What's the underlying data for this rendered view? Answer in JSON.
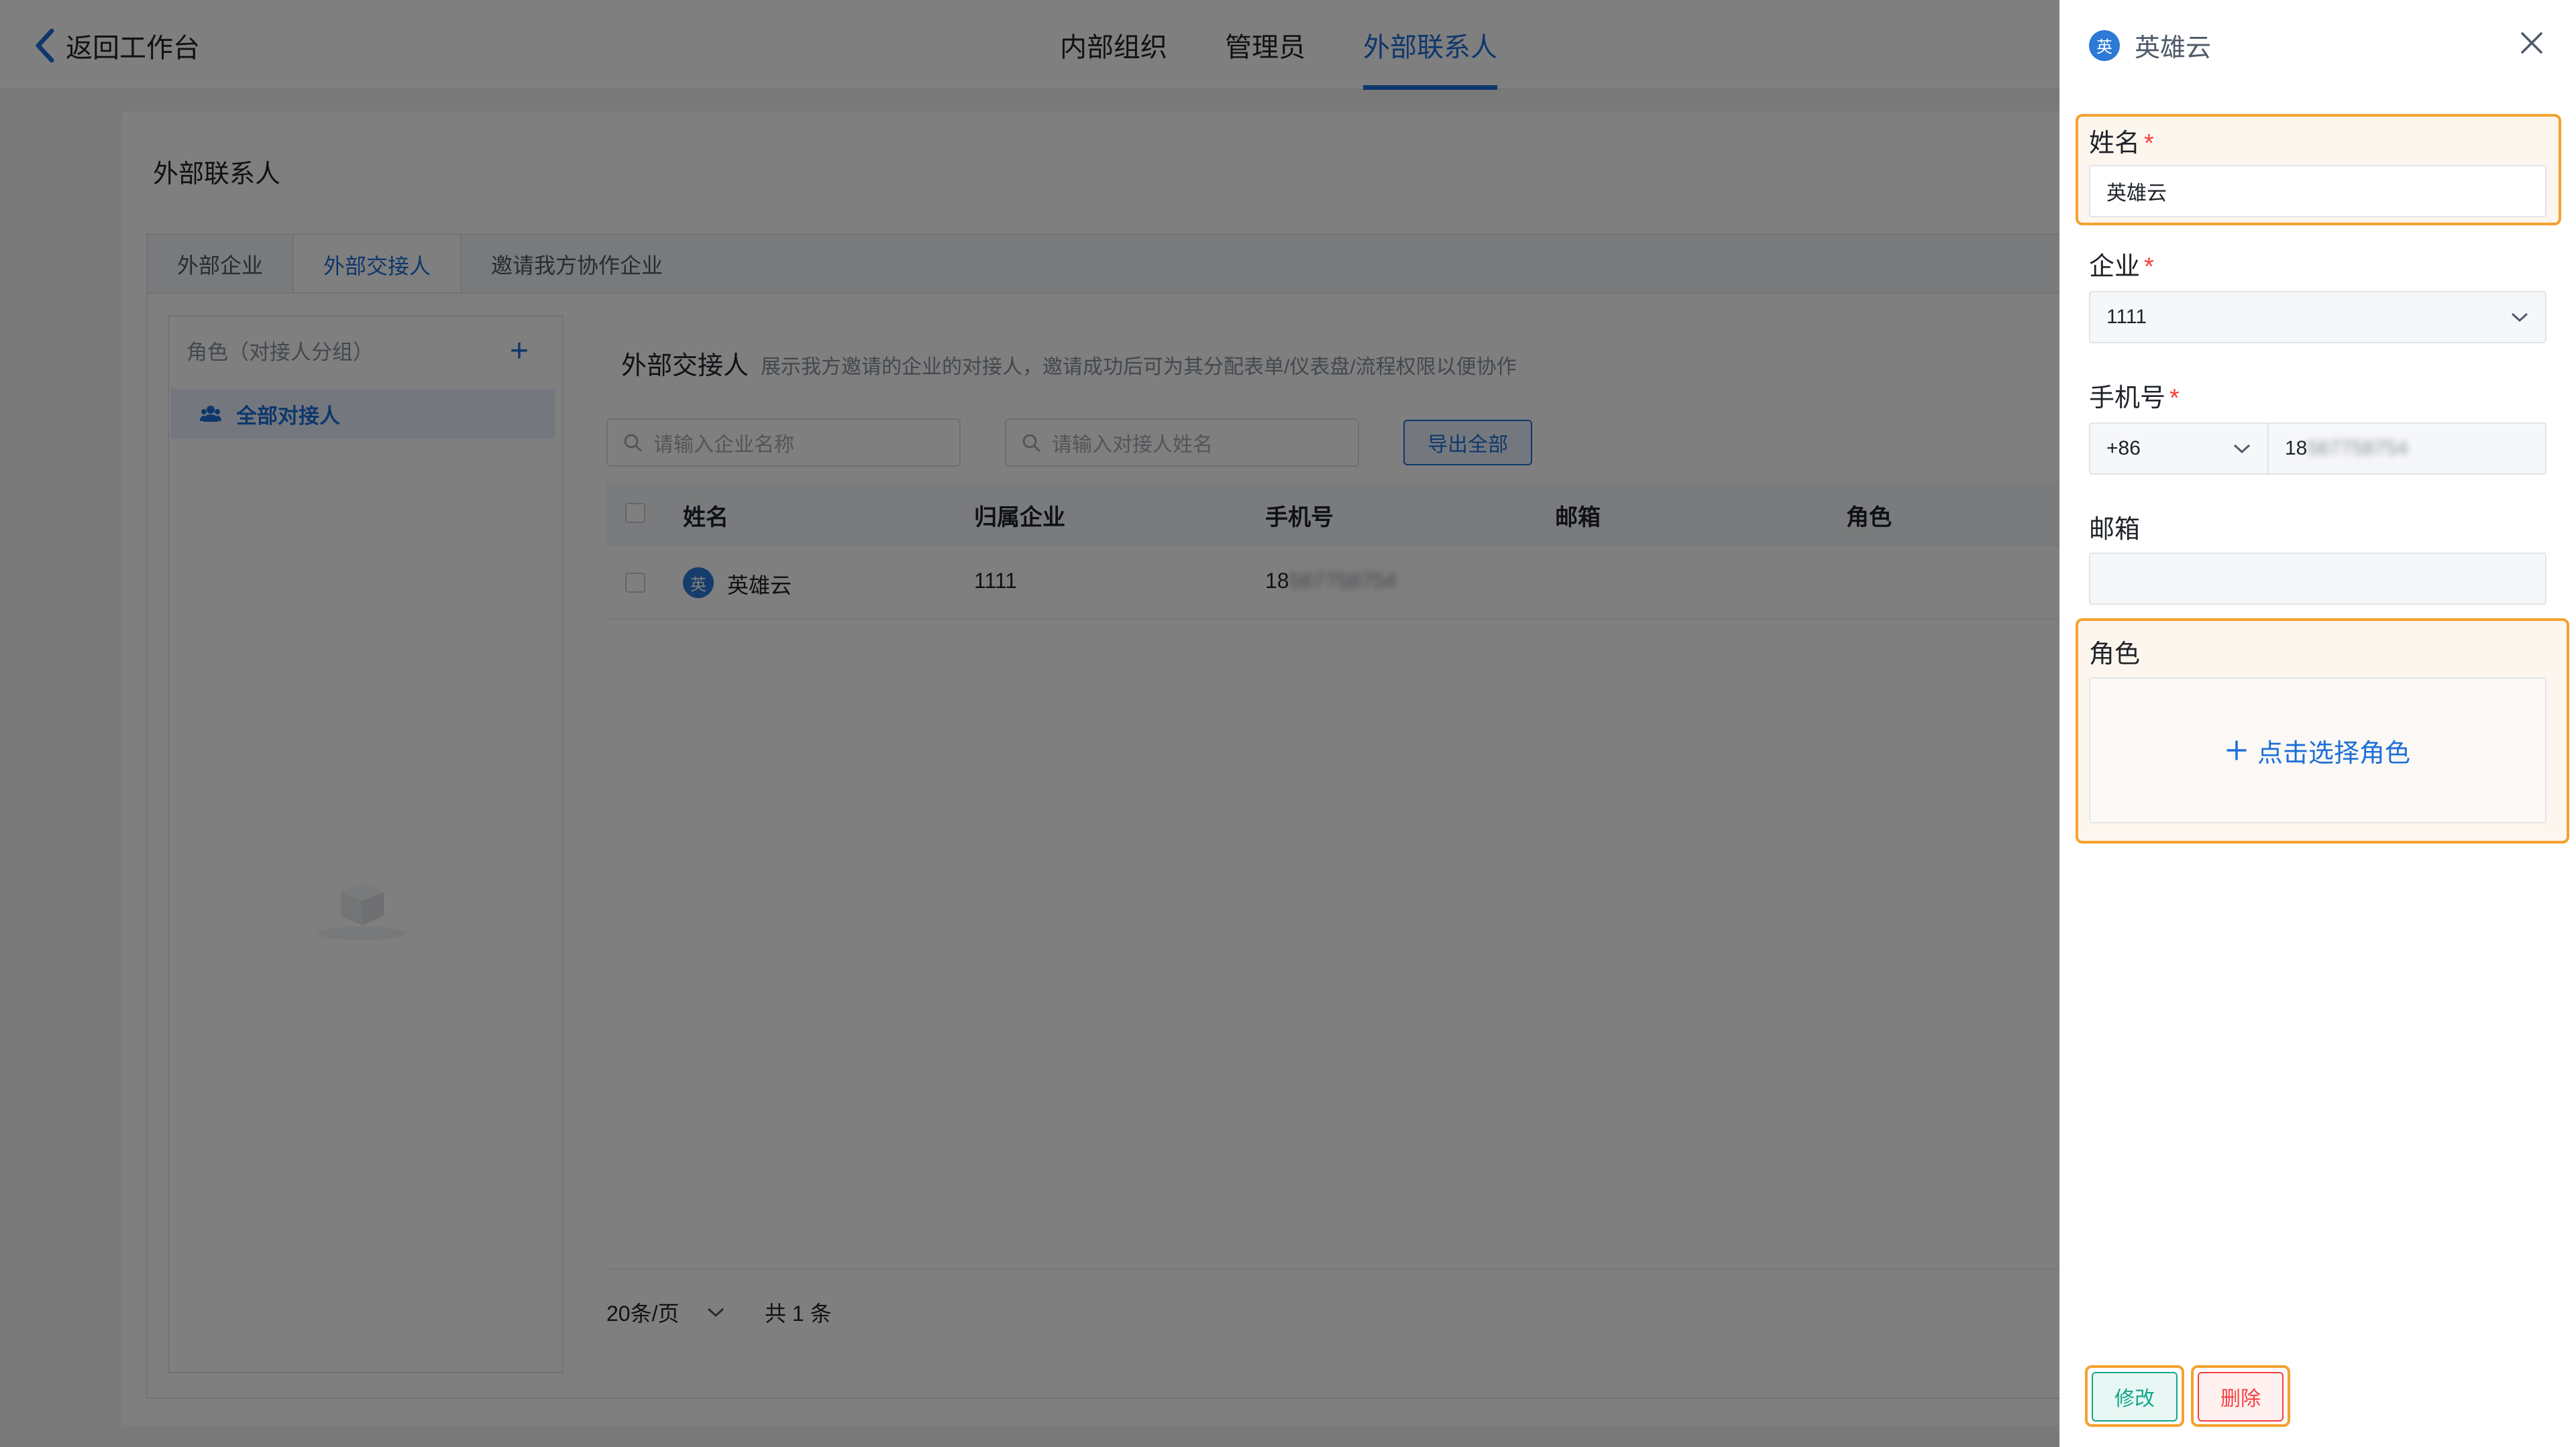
{
  "topbar": {
    "back_label": "返回工作台",
    "tabs": [
      {
        "label": "内部组织",
        "active": false
      },
      {
        "label": "管理员",
        "active": false
      },
      {
        "label": "外部联系人",
        "active": true
      }
    ]
  },
  "page": {
    "title": "外部联系人",
    "subtabs": [
      {
        "label": "外部企业",
        "active": false
      },
      {
        "label": "外部交接人",
        "active": true
      },
      {
        "label": "邀请我方协作企业",
        "active": false
      }
    ]
  },
  "role_panel": {
    "header": "角色（对接人分组）",
    "add_symbol": "+",
    "items": [
      {
        "label": "全部对接人",
        "icon": "users-icon",
        "selected": true
      }
    ]
  },
  "contacts": {
    "title": "外部交接人",
    "description": "展示我方邀请的企业的对接人，邀请成功后可为其分配表单/仪表盘/流程权限以便协作",
    "search_company_placeholder": "请输入企业名称",
    "search_name_placeholder": "请输入对接人姓名",
    "export_label": "导出全部",
    "columns": [
      "姓名",
      "归属企业",
      "手机号",
      "邮箱",
      "角色"
    ],
    "rows": [
      {
        "avatar": "英",
        "name": "英雄云",
        "company": "1111",
        "phone_prefix": "18",
        "phone_masked": "567758754",
        "email": "",
        "role": ""
      }
    ],
    "pager": {
      "page_size": "20条/页",
      "total": "共 1 条"
    }
  },
  "drawer": {
    "avatar": "英",
    "title": "英雄云",
    "fields": {
      "name": {
        "label": "姓名",
        "required": "*",
        "value": "英雄云"
      },
      "company": {
        "label": "企业",
        "required": "*",
        "value": "1111"
      },
      "phone": {
        "label": "手机号",
        "required": "*",
        "country_code": "+86",
        "prefix": "18",
        "masked": "567758754"
      },
      "email": {
        "label": "邮箱",
        "value": ""
      },
      "role": {
        "label": "角色",
        "action": "点击选择角色"
      }
    },
    "buttons": {
      "edit": "修改",
      "delete": "删除"
    }
  },
  "colors": {
    "accent": "#1d6fd8",
    "highlight": "#f5a12f",
    "danger": "#f53f3f",
    "success": "#12a68a"
  }
}
